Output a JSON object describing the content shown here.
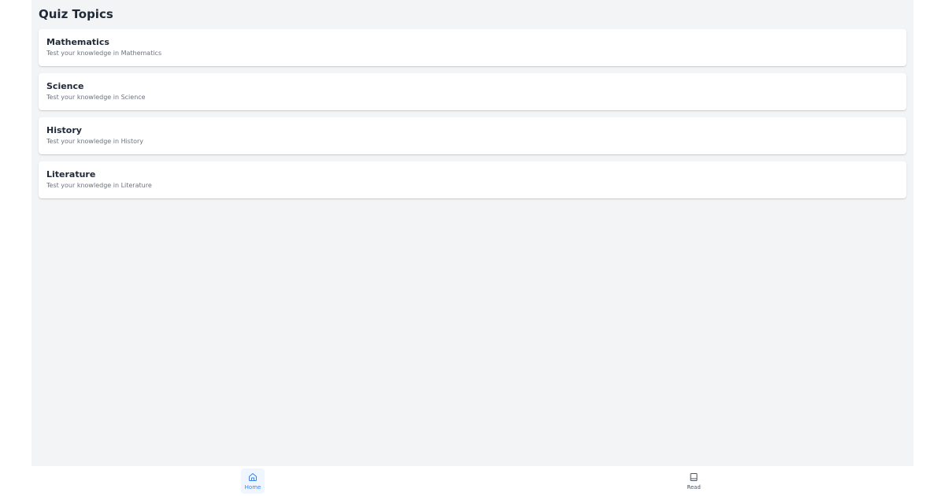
{
  "page": {
    "title": "Quiz Topics"
  },
  "topics": [
    {
      "title": "Mathematics",
      "description": "Test your knowledge in Mathematics"
    },
    {
      "title": "Science",
      "description": "Test your knowledge in Science"
    },
    {
      "title": "History",
      "description": "Test your knowledge in History"
    },
    {
      "title": "Literature",
      "description": "Test your knowledge in Literature"
    }
  ],
  "bottom_nav": {
    "items": [
      {
        "label": "Home",
        "icon": "home-icon",
        "active": true
      },
      {
        "label": "Read",
        "icon": "book-icon",
        "active": false
      }
    ]
  },
  "colors": {
    "accent": "#3b82f6",
    "accent_bg": "#eff6ff",
    "background": "#f3f4f6",
    "card": "#ffffff",
    "text_primary": "#1f2937",
    "text_secondary": "#6b7280"
  }
}
